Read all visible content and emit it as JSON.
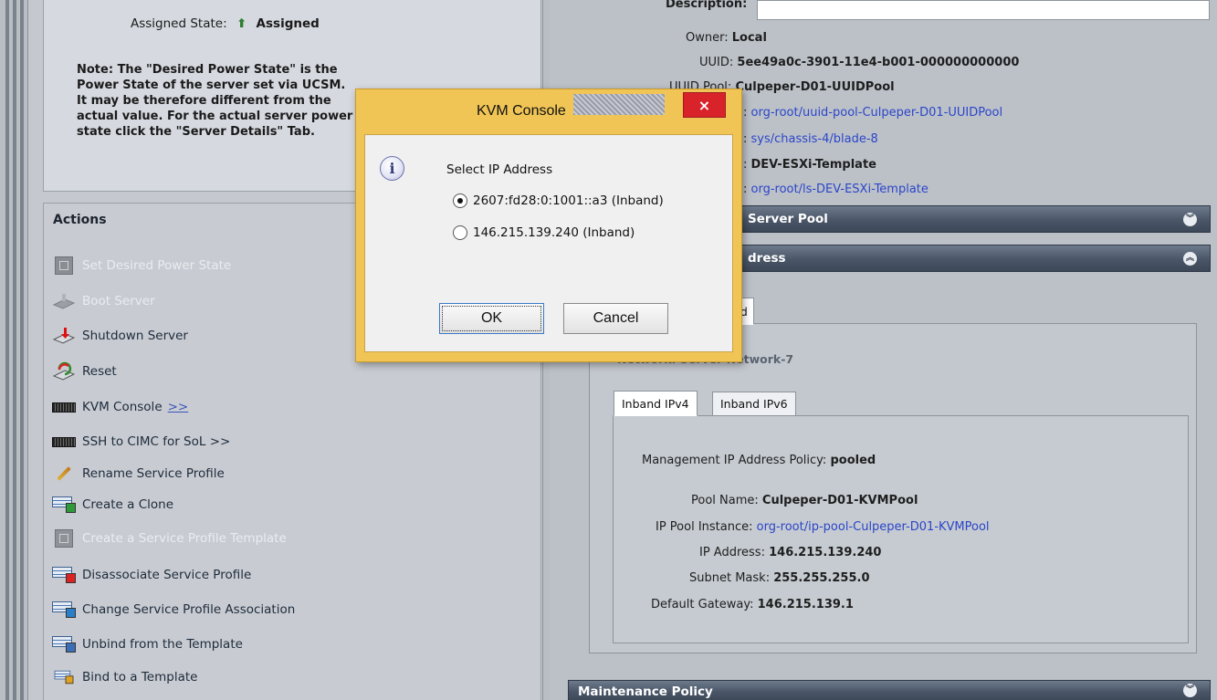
{
  "left": {
    "assigned_state_label": "Assigned State:",
    "assigned_state_value": "Assigned",
    "note_lines": [
      "Note: The \"Desired Power State\" is the",
      "Power State of the server set via UCSM.",
      "It may be therefore different from the",
      "actual value. For the actual server power",
      "state click the \"Server Details\" Tab."
    ],
    "actions_title": "Actions",
    "actions": [
      {
        "label": "Set Desired Power State",
        "icon": "power-state-icon",
        "disabled": true
      },
      {
        "label": "Boot Server",
        "icon": "boot-server-icon",
        "disabled": true
      },
      {
        "label": "Shutdown Server",
        "icon": "shutdown-server-icon",
        "disabled": false
      },
      {
        "label": "Reset",
        "icon": "reset-icon",
        "disabled": false
      },
      {
        "label": "KVM Console",
        "link": ">>",
        "icon": "kvm-console-icon",
        "disabled": false
      },
      {
        "label": "SSH to CIMC for SoL >>",
        "icon": "ssh-icon",
        "disabled": false
      },
      {
        "label": "Rename Service Profile",
        "icon": "pencil-icon",
        "disabled": false
      },
      {
        "label": "Create a Clone",
        "icon": "clone-icon",
        "disabled": false
      },
      {
        "label": "Create a Service Profile Template",
        "icon": "template-icon",
        "disabled": true
      },
      {
        "label": "Disassociate Service Profile",
        "icon": "disassociate-icon",
        "disabled": false
      },
      {
        "label": "Change Service Profile Association",
        "icon": "change-association-icon",
        "disabled": false
      },
      {
        "label": "Unbind from the Template",
        "icon": "unbind-icon",
        "disabled": false
      },
      {
        "label": "Bind to a Template",
        "icon": "bind-icon",
        "disabled": false
      }
    ]
  },
  "right": {
    "description_label": "Description:",
    "owner_label": "Owner:",
    "owner_value": "Local",
    "uuid_label": "UUID:",
    "uuid_value": "5ee49a0c-3901-11e4-b001-000000000000",
    "uuid_pool_label": "UUID Pool:",
    "uuid_pool_value": "Culpeper-D01-UUIDPool",
    "uuid_pool_instance_value": "org-root/uuid-pool-Culpeper-D01-UUIDPool",
    "associated_server_value": "sys/chassis-4/blade-8",
    "template_name_value": "DEV-ESXi-Template",
    "template_instance_value": "org-root/ls-DEV-ESXi-Template",
    "server_pool_bar": "Server Pool",
    "mgmt_ip_bar": "Management IP Address",
    "mgmt_ip_bar_visible": "dress",
    "outer_tab_visible": "nd",
    "network_label": "Network:",
    "network_value": "Server Network-7",
    "inner_tabs": [
      "Inband IPv4",
      "Inband IPv6"
    ],
    "mgmt_policy_label": "Management IP Address Policy:",
    "mgmt_policy_value": "pooled",
    "pool_name_label": "Pool Name:",
    "pool_name_value": "Culpeper-D01-KVMPool",
    "ip_pool_instance_label": "IP Pool Instance:",
    "ip_pool_instance_value": "org-root/ip-pool-Culpeper-D01-KVMPool",
    "ip_address_label": "IP Address:",
    "ip_address_value": "146.215.139.240",
    "subnet_label": "Subnet Mask:",
    "subnet_value": "255.255.255.0",
    "gateway_label": "Default Gateway:",
    "gateway_value": "146.215.139.1",
    "maintenance_bar": "Maintenance Policy"
  },
  "dialog": {
    "title": "KVM Console",
    "close": "×",
    "prompt": "Select IP Address",
    "options": [
      "2607:fd28:0:1001::a3 (Inband)",
      "146.215.139.240 (Inband)"
    ],
    "selected_index": 0,
    "ok_label": "OK",
    "cancel_label": "Cancel"
  },
  "colors": {
    "dialog_frame": "#f0c555",
    "close_button": "#d9232b",
    "link": "#2b45c8",
    "section_bar": "#4a5668"
  }
}
